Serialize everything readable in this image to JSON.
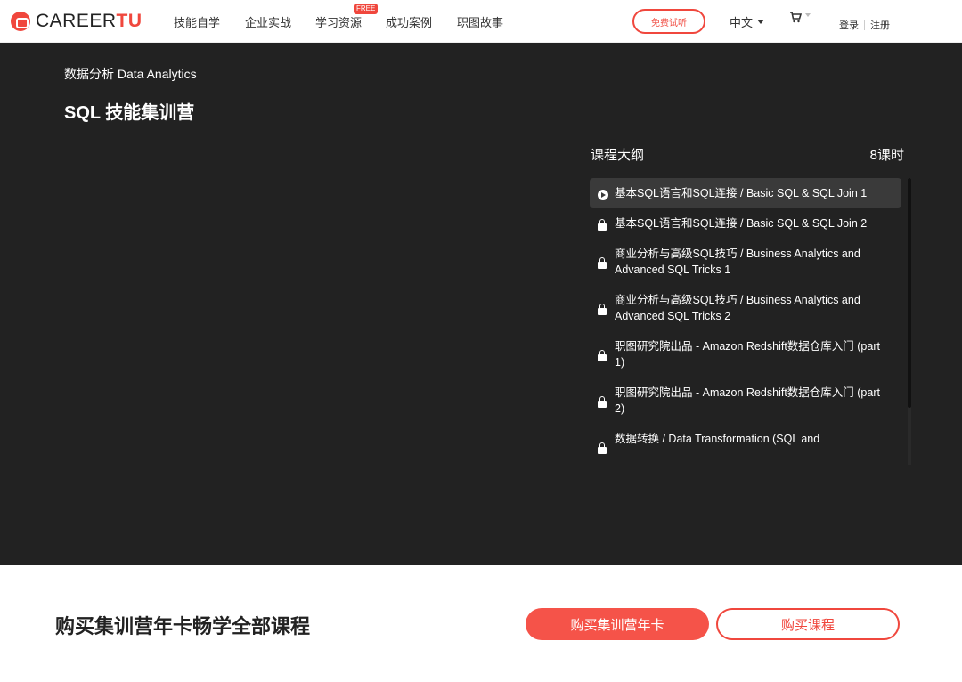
{
  "header": {
    "logo_text_main": "CAREER",
    "logo_text_accent": "TU",
    "nav": [
      "技能自学",
      "企业实战",
      "学习资源",
      "成功案例",
      "职图故事"
    ],
    "free_badge": "FREE",
    "trial_button": "免费试听",
    "language": "中文",
    "cart_icon": "cart-icon",
    "login": "登录",
    "register": "注册"
  },
  "hero": {
    "breadcrumb": "数据分析 Data Analytics",
    "title": "SQL 技能集训营",
    "syllabus_label": "课程大纲",
    "lesson_count": "8课时",
    "lessons": [
      "基本SQL语言和SQL连接 / Basic SQL & SQL Join 1",
      "基本SQL语言和SQL连接 / Basic SQL & SQL Join 2",
      "商业分析与高级SQL技巧 / Business Analytics and Advanced SQL Tricks 1",
      "商业分析与高级SQL技巧 / Business Analytics and Advanced SQL Tricks 2",
      "职图研究院出品 - Amazon Redshift数据仓库入门 (part 1)",
      "职图研究院出品 - Amazon Redshift数据仓库入门 (part 2)",
      "数据转换 / Data Transformation (SQL and"
    ]
  },
  "promo": {
    "text": "购买集训营年卡畅学全部课程",
    "primary_button": "购买集训营年卡",
    "secondary_button": "购买课程"
  },
  "colors": {
    "accent": "#f0473d",
    "hero_bg": "#222222"
  }
}
